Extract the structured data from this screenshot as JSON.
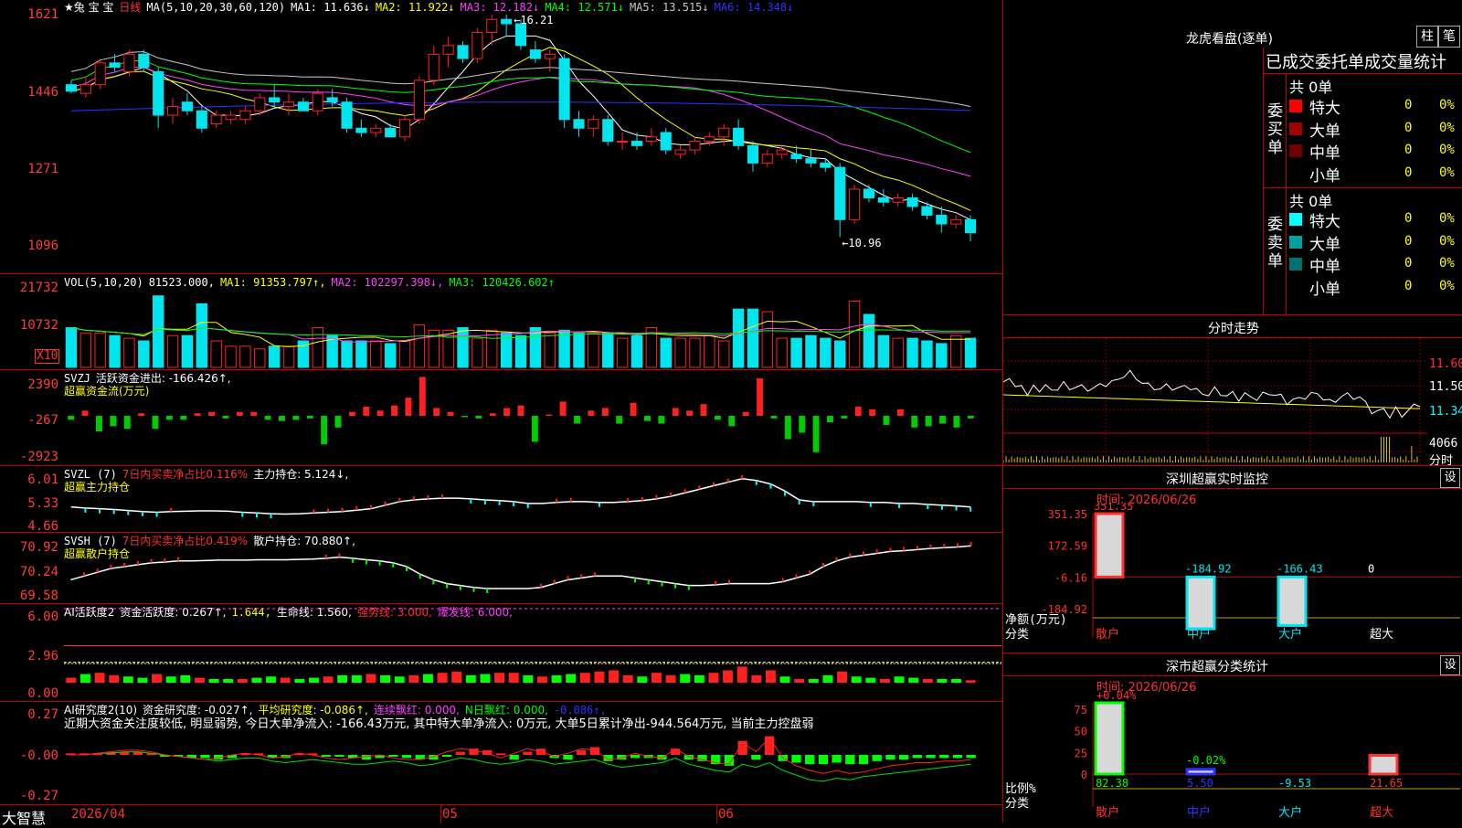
{
  "app": {
    "name": "大智慧"
  },
  "colors": {
    "up": "#ff2020",
    "down": "#00e5ee",
    "ma1": "#ffffff",
    "ma2": "#ffff00",
    "ma3": "#ff40ff",
    "ma4": "#00ff00",
    "ma5": "#c8c8c8",
    "ma6": "#3030ff",
    "grid": "#c00000"
  },
  "kline": {
    "header": {
      "stock": "★兔 宝 宝",
      "period": "日线",
      "ma_def": "MA(5,10,20,30,60,120)",
      "ma": [
        {
          "label": "MA1: 11.636↓",
          "color": "#ffffff"
        },
        {
          "label": "MA2: 11.922↓",
          "color": "#ffff00"
        },
        {
          "label": "MA3: 12.182↓",
          "color": "#ff40ff"
        },
        {
          "label": "MA4: 12.571↓",
          "color": "#00ff00"
        },
        {
          "label": "MA5: 13.515↓",
          "color": "#c8c8c8"
        },
        {
          "label": "MA6: 14.348↓",
          "color": "#3030ff"
        }
      ]
    },
    "yticks": [
      "1621",
      "1446",
      "1271",
      "1096"
    ],
    "high_label": "16.21",
    "low_label": "10.96",
    "x_labels": [
      "2026/04",
      "05",
      "06"
    ]
  },
  "chart_data": [
    {
      "type": "candlestick",
      "title": "日线",
      "y_scale_note": "axis printed ×100",
      "yticks": [
        16.21,
        14.46,
        12.71,
        10.96
      ],
      "high": 16.21,
      "low": 10.96,
      "ohlc": [
        [
          14.6,
          14.7,
          14.4,
          14.45
        ],
        [
          14.4,
          14.8,
          14.3,
          14.6
        ],
        [
          14.6,
          15.2,
          14.5,
          15.1
        ],
        [
          15.1,
          15.3,
          14.9,
          15.0
        ],
        [
          14.9,
          15.4,
          14.8,
          15.3
        ],
        [
          15.3,
          15.4,
          14.9,
          15.0
        ],
        [
          14.9,
          15.0,
          13.6,
          13.9
        ],
        [
          13.9,
          14.3,
          13.7,
          14.1
        ],
        [
          14.2,
          14.4,
          13.9,
          14.0
        ],
        [
          14.0,
          14.1,
          13.5,
          13.6
        ],
        [
          13.7,
          14.0,
          13.6,
          13.9
        ],
        [
          13.8,
          14.0,
          13.7,
          13.9
        ],
        [
          13.8,
          14.1,
          13.7,
          14.0
        ],
        [
          14.0,
          14.4,
          13.9,
          14.3
        ],
        [
          14.3,
          14.6,
          14.1,
          14.2
        ],
        [
          14.1,
          14.4,
          13.9,
          14.2
        ],
        [
          14.2,
          14.3,
          14.0,
          14.0
        ],
        [
          14.0,
          14.5,
          13.9,
          14.4
        ],
        [
          14.3,
          14.5,
          14.1,
          14.2
        ],
        [
          14.2,
          14.3,
          13.5,
          13.6
        ],
        [
          13.6,
          13.8,
          13.4,
          13.5
        ],
        [
          13.5,
          13.7,
          13.4,
          13.6
        ],
        [
          13.6,
          13.7,
          13.4,
          13.4
        ],
        [
          13.4,
          13.9,
          13.3,
          13.8
        ],
        [
          13.8,
          14.8,
          13.7,
          14.7
        ],
        [
          14.7,
          15.5,
          14.6,
          15.3
        ],
        [
          15.3,
          15.7,
          15.0,
          15.5
        ],
        [
          15.5,
          15.6,
          15.1,
          15.2
        ],
        [
          15.2,
          15.9,
          15.1,
          15.8
        ],
        [
          15.8,
          16.2,
          15.5,
          16.1
        ],
        [
          16.1,
          16.21,
          15.7,
          16.0
        ],
        [
          16.0,
          16.1,
          15.4,
          15.5
        ],
        [
          15.4,
          15.6,
          15.1,
          15.2
        ],
        [
          15.2,
          15.4,
          14.9,
          15.3
        ],
        [
          15.2,
          15.3,
          13.6,
          13.8
        ],
        [
          13.8,
          14.0,
          13.4,
          13.6
        ],
        [
          13.6,
          13.9,
          13.4,
          13.8
        ],
        [
          13.8,
          13.9,
          13.2,
          13.3
        ],
        [
          13.3,
          13.5,
          13.1,
          13.3
        ],
        [
          13.3,
          13.5,
          13.1,
          13.2
        ],
        [
          13.3,
          13.6,
          13.2,
          13.4
        ],
        [
          13.5,
          13.6,
          13.0,
          13.1
        ],
        [
          13.0,
          13.2,
          12.9,
          13.1
        ],
        [
          13.1,
          13.4,
          13.0,
          13.3
        ],
        [
          13.3,
          13.5,
          13.2,
          13.4
        ],
        [
          13.4,
          13.7,
          13.2,
          13.6
        ],
        [
          13.6,
          13.8,
          13.1,
          13.2
        ],
        [
          13.2,
          13.3,
          12.6,
          12.8
        ],
        [
          12.8,
          13.1,
          12.7,
          13.0
        ],
        [
          13.0,
          13.2,
          12.9,
          13.1
        ],
        [
          13.0,
          13.2,
          12.8,
          12.9
        ],
        [
          12.9,
          13.1,
          12.7,
          12.8
        ],
        [
          12.8,
          12.9,
          12.6,
          12.7
        ],
        [
          12.7,
          12.8,
          11.1,
          11.5
        ],
        [
          11.5,
          12.3,
          11.4,
          12.2
        ],
        [
          12.2,
          12.3,
          11.9,
          12.0
        ],
        [
          12.0,
          12.2,
          11.8,
          11.9
        ],
        [
          11.9,
          12.1,
          11.8,
          12.0
        ],
        [
          12.0,
          12.1,
          11.7,
          11.8
        ],
        [
          11.8,
          11.9,
          11.5,
          11.6
        ],
        [
          11.6,
          11.8,
          11.2,
          11.4
        ],
        [
          11.4,
          11.6,
          11.3,
          11.5
        ],
        [
          11.5,
          11.6,
          11.0,
          11.2
        ]
      ]
    },
    {
      "type": "bar",
      "title": "VOL(5,10,20)",
      "series_labels": [
        "81523.000",
        "MA1: 91353.797↑",
        "MA2: 102297.398↓",
        "MA3: 120426.602↑"
      ],
      "yticks": [
        "21732",
        "10732"
      ],
      "unit": "X10",
      "values": [
        15,
        13,
        13,
        12,
        11,
        10,
        27,
        12,
        12,
        24,
        10,
        8,
        8,
        7,
        8,
        8,
        10,
        15,
        12,
        10,
        10,
        10,
        9,
        10,
        16,
        14,
        14,
        15,
        11,
        14,
        13,
        12,
        15,
        13,
        14,
        13,
        13,
        13,
        11,
        12,
        15,
        11,
        11,
        11,
        12,
        10,
        22,
        22,
        21,
        11,
        11,
        12,
        11,
        10,
        25,
        20,
        12,
        11,
        11,
        10,
        9,
        12,
        11,
        11,
        10,
        10,
        9,
        10
      ]
    },
    {
      "type": "bar",
      "title": "SVZJ",
      "series_labels": [
        "活跃资金进出: -166.426↑,",
        "超赢资金流(万元)"
      ],
      "yticks": [
        "2390",
        "-267",
        "-2923"
      ],
      "values": [
        -300,
        400,
        -1200,
        -800,
        -1000,
        200,
        -1000,
        -300,
        -300,
        200,
        300,
        -200,
        300,
        300,
        -300,
        -400,
        -300,
        -200,
        -2200,
        -900,
        300,
        700,
        400,
        800,
        1400,
        3000,
        600,
        300,
        -100,
        -200,
        200,
        600,
        800,
        -2000,
        100,
        1100,
        -600,
        400,
        600,
        -600,
        1000,
        -400,
        -600,
        600,
        400,
        900,
        -300,
        -800,
        300,
        2900,
        -200,
        -1800,
        -1300,
        -2800,
        -500,
        -200,
        700,
        500,
        -700,
        500,
        -900,
        -800,
        -600,
        -900,
        -200
      ]
    },
    {
      "type": "line",
      "title": "SVZL (7)",
      "series_labels": [
        "7日内买卖净占比0.116%",
        "主力持仓: 5.124↓,",
        "超赢主力持仓"
      ],
      "yticks": [
        "6.01",
        "5.33",
        "4.66"
      ],
      "values": [
        5.15,
        5.12,
        5.1,
        5.08,
        5.05,
        5.02,
        5.0,
        5.02,
        5.03,
        5.04,
        5.04,
        5.03,
        5.0,
        4.98,
        4.96,
        4.95,
        4.96,
        4.98,
        5.0,
        5.02,
        5.06,
        5.1,
        5.2,
        5.3,
        5.35,
        5.38,
        5.4,
        5.4,
        5.38,
        5.35,
        5.33,
        5.3,
        5.25,
        5.25,
        5.28,
        5.3,
        5.3,
        5.28,
        5.28,
        5.3,
        5.33,
        5.38,
        5.45,
        5.55,
        5.65,
        5.75,
        5.85,
        5.95,
        5.9,
        5.8,
        5.6,
        5.35,
        5.3,
        5.3,
        5.3,
        5.3,
        5.28,
        5.28,
        5.25,
        5.25,
        5.22,
        5.2,
        5.18,
        5.15
      ]
    },
    {
      "type": "line",
      "title": "SVSH (7)",
      "series_labels": [
        "7日内买卖净占比0.419%",
        "散户持仓: 70.880↑,",
        "超赢散户持仓"
      ],
      "yticks": [
        "70.92",
        "70.24",
        "69.58"
      ],
      "values": [
        69.95,
        70.05,
        70.15,
        70.25,
        70.3,
        70.35,
        70.4,
        70.42,
        70.45,
        70.45,
        70.46,
        70.47,
        70.47,
        70.47,
        70.48,
        70.48,
        70.48,
        70.49,
        70.5,
        70.52,
        70.55,
        70.52,
        70.48,
        70.45,
        70.4,
        70.3,
        70.1,
        69.95,
        69.85,
        69.8,
        69.75,
        69.72,
        69.72,
        69.72,
        69.72,
        69.75,
        69.85,
        69.95,
        70.0,
        70.05,
        70.05,
        70.05,
        70.0,
        69.95,
        69.9,
        69.85,
        69.8,
        69.8,
        69.82,
        69.85,
        69.85,
        69.85,
        69.85,
        69.9,
        70.0,
        70.1,
        70.3,
        70.45,
        70.55,
        70.6,
        70.65,
        70.7,
        70.72,
        70.75,
        70.78,
        70.8,
        70.82,
        70.85
      ]
    },
    {
      "type": "bar",
      "title": "AI活跃度2",
      "series_labels": [
        "资金活跃度: 0.267↑,",
        "1.644,",
        "生命线: 1.560,",
        "强势线: 3.000,",
        "爆发线: 6.000,"
      ],
      "yticks": [
        "6.00",
        "2.96",
        "0.00"
      ],
      "values": [
        0.4,
        0.7,
        0.8,
        0.6,
        0.5,
        0.4,
        0.7,
        0.5,
        0.6,
        0.4,
        0.3,
        0.3,
        0.3,
        0.4,
        0.5,
        0.4,
        0.3,
        0.4,
        0.5,
        0.6,
        0.6,
        0.7,
        0.6,
        0.5,
        0.6,
        0.7,
        0.8,
        0.9,
        0.6,
        0.7,
        0.8,
        0.8,
        0.6,
        0.5,
        0.6,
        0.7,
        0.8,
        0.9,
        1.0,
        0.6,
        0.5,
        0.8,
        0.6,
        0.7,
        0.6,
        0.8,
        1.0,
        1.3,
        0.6,
        1.0,
        0.5,
        0.3,
        0.3,
        0.6,
        0.9,
        0.5,
        0.4,
        0.3,
        0.5,
        0.4,
        0.3,
        0.3,
        0.3,
        0.2
      ]
    },
    {
      "type": "bar",
      "title": "AI研究度2(10)",
      "series_labels": [
        "资金研究度: -0.027↑,",
        "平均研究度: -0.086↑,",
        "连续飘红: 0.000,",
        "N日飘红: 0.000,",
        "-0.086↑,"
      ],
      "yticks": [
        "0.27",
        "-0.00",
        "-0.27"
      ],
      "values": [
        0.01,
        0.01,
        0.01,
        0.02,
        0.02,
        0.02,
        0.01,
        -0.01,
        -0.01,
        -0.02,
        -0.02,
        -0.03,
        -0.02,
        0.01,
        0.01,
        -0.02,
        -0.02,
        0.01,
        0.01,
        -0.01,
        -0.01,
        -0.02,
        -0.03,
        -0.02,
        -0.01,
        -0.02,
        -0.03,
        -0.03,
        -0.01,
        0.02,
        0.04,
        0.03,
        0.01,
        -0.03,
        0.02,
        0.04,
        -0.02,
        -0.03,
        0.03,
        0.05,
        -0.04,
        -0.03,
        -0.02,
        -0.02,
        -0.03,
        0.04,
        -0.03,
        -0.04,
        -0.06,
        -0.07,
        0.09,
        -0.03,
        0.12,
        -0.04,
        -0.05,
        -0.06,
        -0.06,
        -0.05,
        -0.06,
        -0.06,
        -0.04,
        -0.03,
        -0.03,
        -0.02,
        -0.02,
        -0.02,
        -0.02,
        -0.02
      ]
    },
    {
      "type": "line",
      "title": "分时走势",
      "yticks": [
        "11.60",
        "11.50",
        "11.34"
      ],
      "vol_label": "4066",
      "x_unit": "分时"
    },
    {
      "type": "bar",
      "title": "深圳超赢实时监控",
      "date_text": "时间: 2026/06/26",
      "yticks": [
        "351.35",
        "172.59",
        "-6.16",
        "-184.92"
      ],
      "ylabel": "净额(万元)",
      "xlabel": "分类",
      "categories": [
        "散户",
        "中户",
        "大户",
        "超大"
      ],
      "values": [
        351.35,
        -184.92,
        -166.43,
        0
      ],
      "value_labels": [
        "351.35",
        "-184.92",
        "-166.43",
        "0"
      ]
    },
    {
      "type": "bar",
      "title": "深市超赢分类统计",
      "date_text": "时间: 2026/06/26",
      "yticks": [
        "75",
        "50",
        "25",
        "0"
      ],
      "ylabel": "比例%",
      "xlabel": "分类",
      "categories": [
        "散户",
        "中户",
        "大户",
        "超大"
      ],
      "values": [
        82.38,
        5.5,
        -9.53,
        21.65
      ],
      "changes": [
        "+0.04%",
        "-0.02%"
      ]
    }
  ],
  "lhb": {
    "title": "龙虎看盘(逐单)",
    "btn_zhu": "柱",
    "btn_bi": "笔",
    "header": "已成交委托单成交量统计",
    "buy": {
      "side_label": "委买单",
      "total": "共 0单",
      "rows": [
        {
          "name": "特大",
          "count": "0",
          "pct": "0%",
          "color": "#ff0000"
        },
        {
          "name": "大单",
          "count": "0",
          "pct": "0%",
          "color": "#a00000"
        },
        {
          "name": "中单",
          "count": "0",
          "pct": "0%",
          "color": "#700000"
        },
        {
          "name": "小单",
          "count": "0",
          "pct": "0%",
          "color": "#000000"
        }
      ]
    },
    "sell": {
      "side_label": "委卖单",
      "total": "共 0单",
      "rows": [
        {
          "name": "特大",
          "count": "0",
          "pct": "0%",
          "color": "#00ffff"
        },
        {
          "name": "大单",
          "count": "0",
          "pct": "0%",
          "color": "#00a0a0"
        },
        {
          "name": "中单",
          "count": "0",
          "pct": "0%",
          "color": "#007070"
        },
        {
          "name": "小单",
          "count": "0",
          "pct": "0%",
          "color": "#000000"
        }
      ]
    }
  },
  "panels": {
    "vol": {
      "title": "VOL(5,10,20)",
      "v": "81523.000,",
      "ma1": "MA1: 91353.797↑,",
      "ma2": "MA2: 102297.398↓,",
      "ma3": "MA3: 120426.602↑"
    },
    "svzj": {
      "title": "SVZJ",
      "l1": "活跃资金进出: -166.426↑,",
      "l2": "超赢资金流(万元)"
    },
    "svzl": {
      "title": "SVZL (7)",
      "l1": "7日内买卖净占比0.116%",
      "l2": "主力持仓: 5.124↓,",
      "l3": "超赢主力持仓"
    },
    "svsh": {
      "title": "SVSH (7)",
      "l1": "7日内买卖净占比0.419%",
      "l2": "散户持仓: 70.880↑,",
      "l3": "超赢散户持仓"
    },
    "ai1": {
      "title": "AI活跃度2",
      "l1": "资金活跃度: 0.267↑,",
      "l2": "1.644,",
      "l3": "生命线: 1.560,",
      "l4": "强势线: 3.000,",
      "l5": "爆发线: 6.000,"
    },
    "ai2": {
      "title": "AI研究度2(10)",
      "l1": "资金研究度: -0.027↑,",
      "l2": "平均研究度: -0.086↑,",
      "l3": "连续飘红: 0.000,",
      "l4": "N日飘红: 0.000,",
      "l5": "-0.086↑,",
      "note": "近期大资金关注度较低, 明显弱势, 今日大单净流入: -166.43万元, 其中特大单净流入: 0万元, 大单5日累计净出-944.564万元, 当前主力控盘弱"
    }
  },
  "minute": {
    "title": "分时走势",
    "yticks": [
      "11.60",
      "11.50",
      "11.34"
    ],
    "vol": "4066",
    "unit": "分时"
  },
  "monitor": {
    "title": "深圳超赢实时监控",
    "set": "设",
    "time": "时间: 2026/06/26",
    "yticks": [
      "351.35",
      "172.59",
      "-6.16",
      "-184.92"
    ],
    "ylabel": "净额(万元)",
    "xlabel": "分类",
    "cats": [
      "散户",
      "中户",
      "大户",
      "超大"
    ],
    "vals": [
      "351.35",
      "-184.92",
      "-166.43",
      "0"
    ]
  },
  "stats": {
    "title": "深市超赢分类统计",
    "set": "设",
    "time": "时间: 2026/06/26",
    "yticks": [
      "75",
      "50",
      "25",
      "0"
    ],
    "ylabel": "比例%",
    "xlabel": "分类",
    "cats": [
      "散户",
      "中户",
      "大户",
      "超大"
    ],
    "vals": [
      "82.38",
      "5.50",
      "-9.53",
      "21.65"
    ],
    "chg": [
      "+0.04%",
      "-0.02%"
    ]
  }
}
